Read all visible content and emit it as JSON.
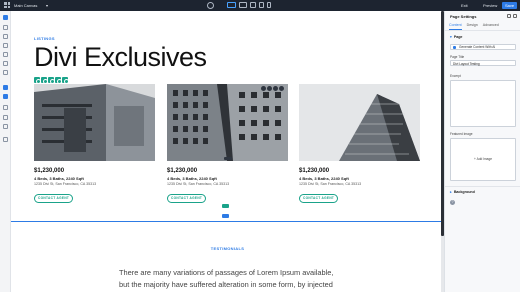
{
  "topbar": {
    "canvas_select": "Main Canvas",
    "exit_label": "Exit",
    "preview_label": "Preview",
    "save_label": "Save"
  },
  "main": {
    "eyebrow": "LISTINGS",
    "title": "Divi Exclusives",
    "listings": [
      {
        "price": "$1,230,000",
        "specs": "4 Beds, 3 Baths, 2240 Sqft",
        "address": "1235 Divi St, San Francisco, CA 35313",
        "cta": "CONTACT AGENT"
      },
      {
        "price": "$1,230,000",
        "specs": "4 Beds, 3 Baths, 2240 Sqft",
        "address": "1235 Divi St, San Francisco, CA 35313",
        "cta": "CONTACT AGENT"
      },
      {
        "price": "$1,230,000",
        "specs": "4 Beds, 3 Baths, 2240 Sqft",
        "address": "1235 Divi St, San Francisco, CA 35313",
        "cta": "CONTACT AGENT"
      }
    ],
    "testimonials_label": "TESTIMONIALS",
    "quote": "There are many variations of passages of Lorem Ipsum available, but the majority have suffered alteration in some form, by injected humour, or"
  },
  "panel": {
    "title": "Page Settings",
    "tabs": [
      "Content",
      "Design",
      "Advanced"
    ],
    "active_tab": "Content",
    "page_group": "Page",
    "ai_button": "Generate Content With AI",
    "page_title_label": "Page Title",
    "page_title_value": "Divi Layout Testing",
    "excerpt_label": "Excerpt",
    "featured_image_label": "Featured Image",
    "add_image": "+  Add Image",
    "background_group": "Background"
  },
  "colors": {
    "accent_blue": "#2d7be5",
    "accent_teal": "#1aa38a",
    "topbar_bg": "#1d2430"
  }
}
